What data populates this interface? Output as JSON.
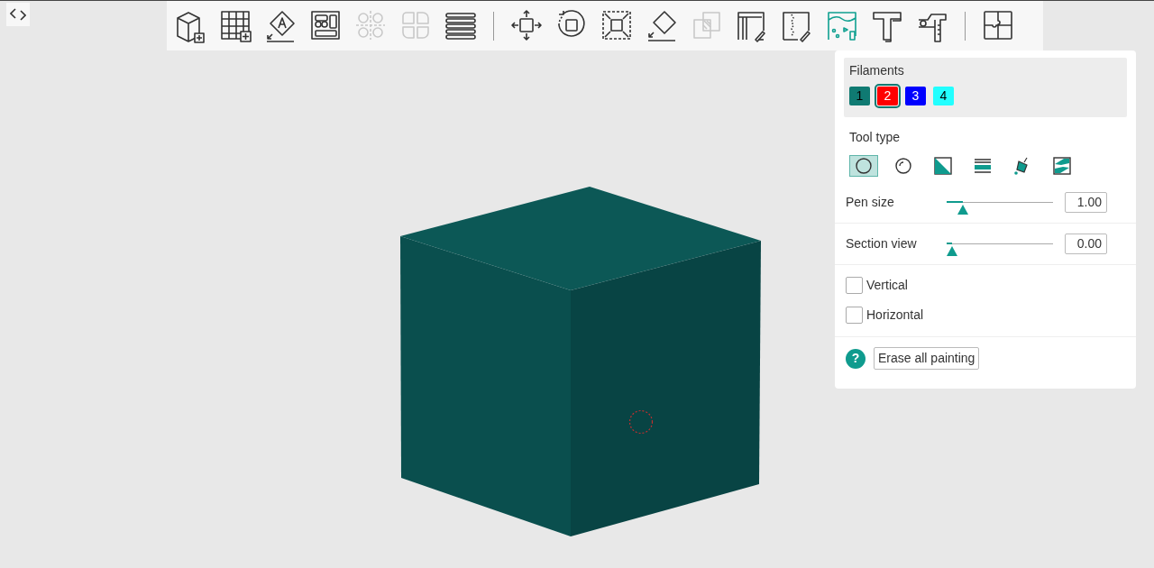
{
  "toolbar": {
    "groups": [
      [
        {
          "kind": "add-cube",
          "disabled": false,
          "selected": false
        },
        {
          "kind": "add-grid",
          "disabled": false,
          "selected": false
        },
        {
          "kind": "emboss-text",
          "disabled": false,
          "selected": false
        },
        {
          "kind": "arrange",
          "disabled": false,
          "selected": false
        },
        {
          "kind": "split-objects",
          "disabled": true,
          "selected": false
        },
        {
          "kind": "split-parts",
          "disabled": true,
          "selected": false
        },
        {
          "kind": "layers",
          "disabled": false,
          "selected": false
        }
      ],
      [
        {
          "kind": "move",
          "disabled": false,
          "selected": false
        },
        {
          "kind": "rotate",
          "disabled": false,
          "selected": false
        },
        {
          "kind": "scale",
          "disabled": false,
          "selected": false
        },
        {
          "kind": "lay-flat",
          "disabled": false,
          "selected": false
        },
        {
          "kind": "cut",
          "disabled": true,
          "selected": false
        },
        {
          "kind": "support-paint",
          "disabled": false,
          "selected": false
        },
        {
          "kind": "seam-paint",
          "disabled": false,
          "selected": false
        },
        {
          "kind": "color-paint",
          "disabled": false,
          "selected": true
        },
        {
          "kind": "text",
          "disabled": false,
          "selected": false
        },
        {
          "kind": "measure",
          "disabled": false,
          "selected": false
        }
      ],
      [
        {
          "kind": "assembly",
          "disabled": false,
          "selected": false
        }
      ]
    ]
  },
  "panel": {
    "filaments": {
      "title": "Filaments",
      "items": [
        {
          "label": "1",
          "color": "#0f7a72",
          "selected": false
        },
        {
          "label": "2",
          "color": "#ff0000",
          "selected": true
        },
        {
          "label": "3",
          "color": "#0000ff",
          "selected": false
        },
        {
          "label": "4",
          "color": "#22ffff",
          "selected": false
        }
      ]
    },
    "tool_type": {
      "title": "Tool type",
      "tools": [
        {
          "kind": "circle",
          "selected": true
        },
        {
          "kind": "sphere",
          "selected": false
        },
        {
          "kind": "triangle",
          "selected": false
        },
        {
          "kind": "height-range",
          "selected": false
        },
        {
          "kind": "fill",
          "selected": false
        },
        {
          "kind": "gap-fill",
          "selected": false
        }
      ]
    },
    "sliders": [
      {
        "label": "Pen size",
        "level": 0.15,
        "value": "1.00"
      },
      {
        "label": "Section view",
        "level": 0.05,
        "value": "0.00"
      }
    ],
    "checkboxes": [
      {
        "label": "Vertical",
        "checked": false
      },
      {
        "label": "Horizontal",
        "checked": false
      }
    ],
    "help": "?",
    "button": "Erase all painting"
  }
}
